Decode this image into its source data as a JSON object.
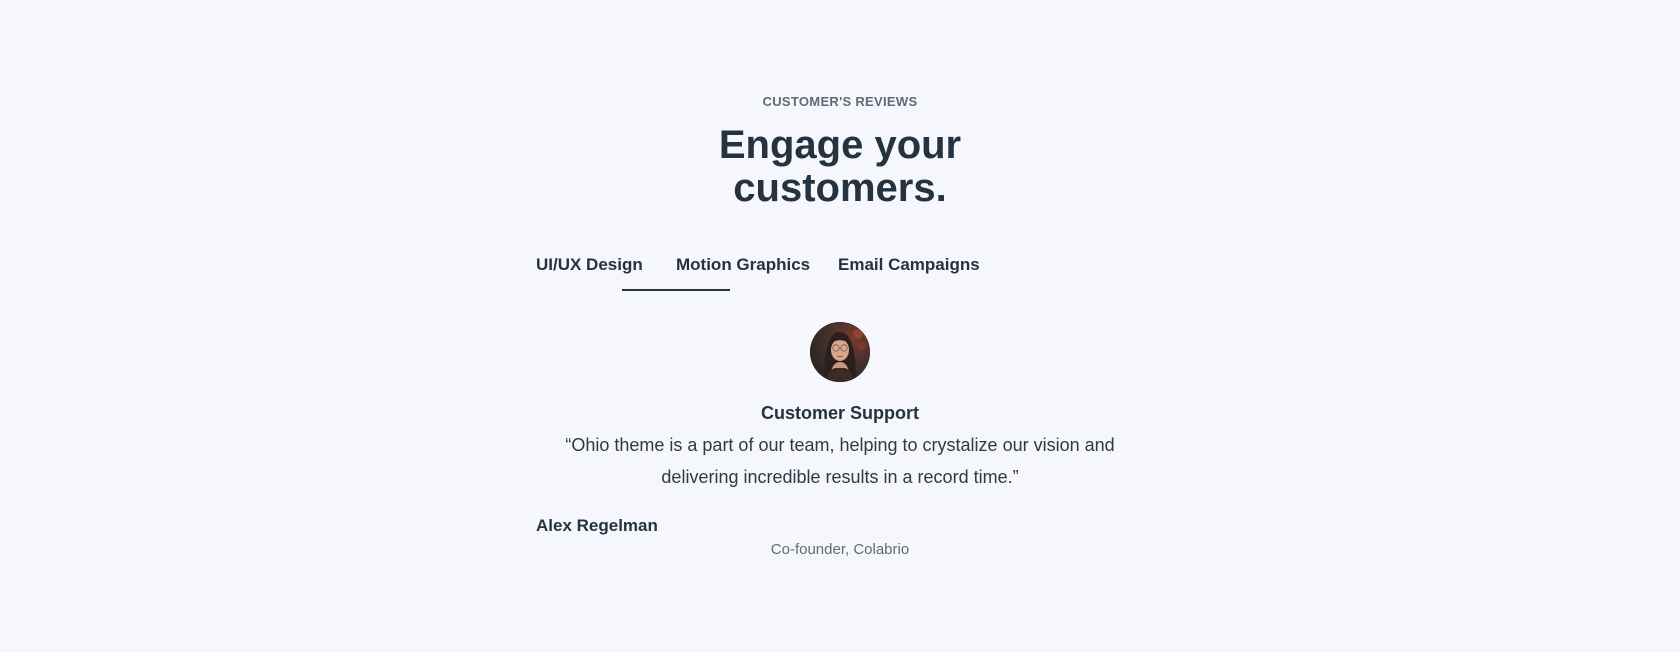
{
  "section": {
    "eyebrow": "CUSTOMER'S REVIEWS",
    "title_line1": "Engage your",
    "title_line2": "customers."
  },
  "tabs": [
    {
      "label": "UI/UX Design",
      "active": false
    },
    {
      "label": "Motion Graphics",
      "active": true
    },
    {
      "label": "Email Campaigns",
      "active": false
    }
  ],
  "testimonial": {
    "avatar_icon": "user-avatar-photo",
    "role": "Customer Support",
    "quote": "“Ohio theme is a part of our team, helping to crystalize our vision and delivering incredible results in a record time.”",
    "author": "Alex Regelman",
    "position": "Co-founder, Colabrio"
  },
  "colors": {
    "background": "#f5f7fc",
    "heading": "#253340",
    "muted": "#5f6b75"
  }
}
